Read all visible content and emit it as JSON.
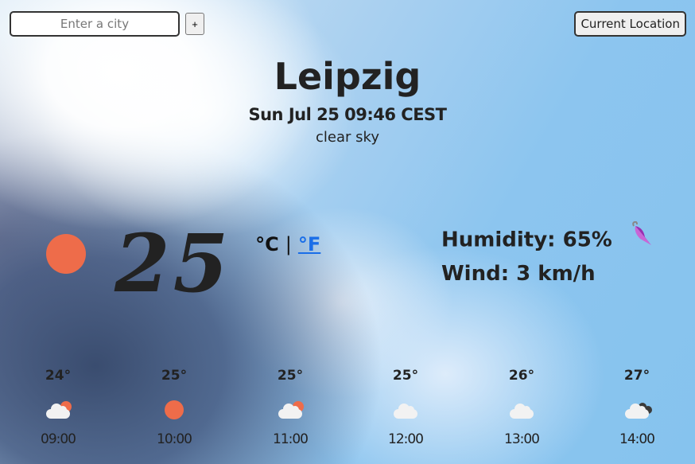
{
  "search": {
    "placeholder": "Enter a city",
    "value": "",
    "add_label": "+"
  },
  "location_button": {
    "label": "Current Location"
  },
  "current": {
    "city": "Leipzig",
    "datetime": "Sun Jul 25 09:46 CEST",
    "description": "clear sky",
    "icon": "sun-icon",
    "temperature": "25",
    "unit_celsius": "°C",
    "unit_separator": "|",
    "unit_fahrenheit": "°F",
    "humidity_label": "Humidity: 65%",
    "humidity_icon": "umbrella-icon",
    "wind_label": "Wind: 3 km/h"
  },
  "colors": {
    "sun": "#ee6c4a",
    "link": "#1a6ee8",
    "text": "#222222"
  },
  "forecast": [
    {
      "temp": "24°",
      "icon": "few-clouds",
      "time": "09:00"
    },
    {
      "temp": "25°",
      "icon": "clear-sky",
      "time": "10:00"
    },
    {
      "temp": "25°",
      "icon": "few-clouds",
      "time": "11:00"
    },
    {
      "temp": "25°",
      "icon": "clouds",
      "time": "12:00"
    },
    {
      "temp": "26°",
      "icon": "clouds",
      "time": "13:00"
    },
    {
      "temp": "27°",
      "icon": "broken-clouds",
      "time": "14:00"
    }
  ]
}
